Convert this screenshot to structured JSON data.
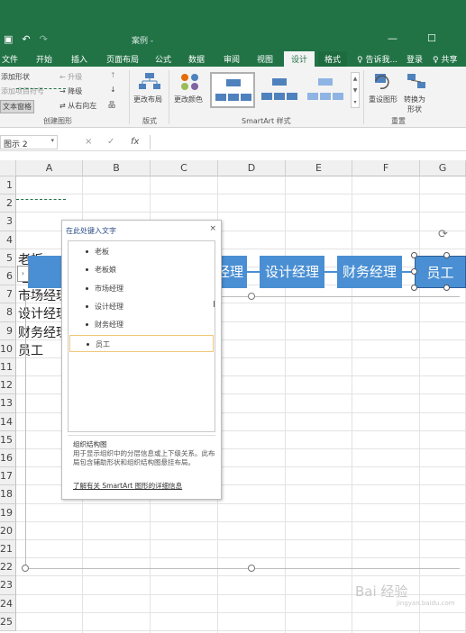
{
  "titlebar": {
    "title": "案例 -",
    "qat": [
      "▣",
      "↶",
      "↷"
    ],
    "minimize": "—",
    "restore": "☐"
  },
  "tabs": {
    "file": "文件",
    "home": "开始",
    "insert": "插入",
    "layout": "页面布局",
    "formulas": "公式",
    "data": "数据",
    "review": "审阅",
    "view": "视图",
    "design": "设计",
    "format": "格式",
    "tellme": "♀ 告诉我...",
    "login": "登录",
    "share": "♀ 共享"
  },
  "ribbon": {
    "create": {
      "add_shape": "添加形状",
      "add_bullet": "添加项目符号",
      "text_pane": "文本窗格",
      "promote": "← 升级",
      "demote": "→ 降级",
      "rtl": "⇄ 从右向左",
      "up": "↑",
      "down": "↓",
      "org": "品",
      "label": "创建图形"
    },
    "layouts": {
      "change_layout": "更改布局",
      "label": "版式"
    },
    "styles": {
      "change_colors": "更改颜色",
      "label": "SmartArt 样式"
    },
    "reset": {
      "reset_graphic": "重设图形",
      "convert": "转换为",
      "convert2": "形状",
      "label": "重置"
    }
  },
  "formula_bar": {
    "name_box": "图示 2",
    "cancel": "×",
    "enter": "✓",
    "fx": "fx"
  },
  "grid": {
    "columns": [
      "A",
      "B",
      "C",
      "D",
      "E",
      "F",
      "G"
    ],
    "rows": [
      "1",
      "2",
      "3",
      "4",
      "5",
      "6",
      "7",
      "8",
      "9",
      "10",
      "11",
      "12",
      "13",
      "14",
      "15",
      "16",
      "17",
      "18",
      "19",
      "20",
      "21",
      "22",
      "23",
      "24",
      "25"
    ],
    "cells": [
      "老板",
      "老板娘",
      "市场经理",
      "设计经理",
      "财务经理",
      "员工"
    ]
  },
  "smartart": {
    "boxes": [
      "老",
      "经理",
      "设计经理",
      "财务经理",
      "员工"
    ],
    "rotate": "⟳"
  },
  "text_pane": {
    "title": "在此处键入文字",
    "close": "×",
    "items": [
      "老板",
      "老板娘",
      "市场经理",
      "设计经理",
      "财务经理",
      "员工"
    ],
    "desc_title": "组织结构图",
    "desc_body": "用于显示组织中的分层信息或上下级关系。此布局包含辅助形状和组织结构图悬挂布局。",
    "desc_link": "了解有关 SmartArt 图形的详细信息"
  },
  "watermark": {
    "main": "Bai 经验",
    "sub": "jingyan.baidu.com"
  }
}
